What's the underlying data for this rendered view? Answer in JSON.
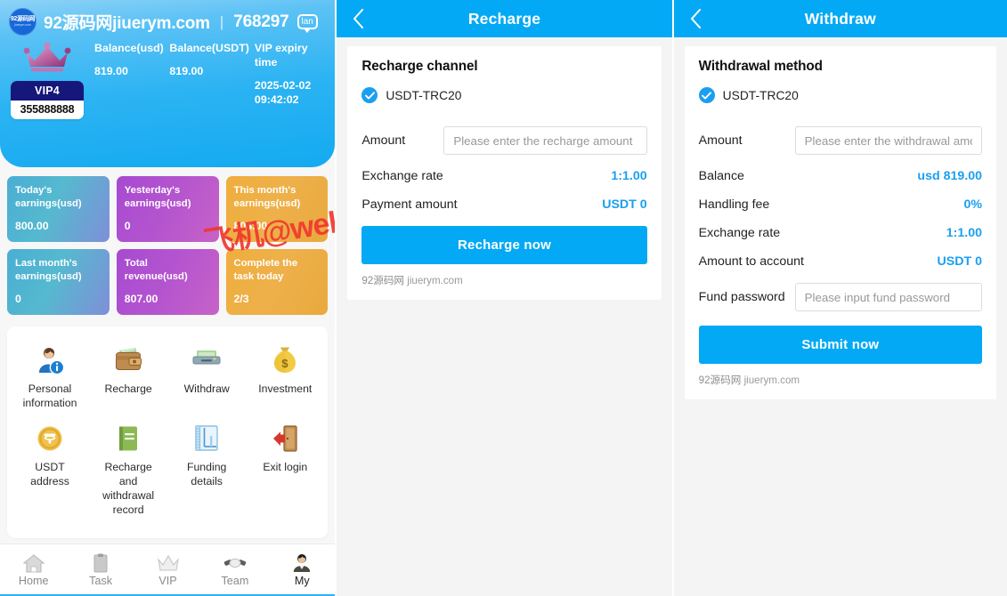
{
  "theme": {
    "accent": "#03a9f4",
    "hero_blue": "#2bb3f3",
    "card_teal": "#4aaed4",
    "card_purple": "#b455cf",
    "card_orange": "#eeb04a",
    "vip_navy": "#16177a",
    "value_blue": "#1a9ff0",
    "watermark_red": "#f0382f"
  },
  "watermark": {
    "text": "飞机@welunt"
  },
  "my_panel": {
    "header": {
      "logo_line1": "92源码网",
      "logo_line2": "jiuerym.com",
      "brand": "92源码网jiuerym.com",
      "divider": "|",
      "uid": "768297",
      "lang_badge": "lan",
      "message_badge": "•••"
    },
    "vip": {
      "level": "VIP4",
      "account": "355888888"
    },
    "balances": [
      {
        "label": "Balance(usd)",
        "value": "819.00"
      },
      {
        "label": "Balance(USDT)",
        "value": "819.00"
      },
      {
        "label": "VIP expiry time",
        "value": "2025-02-02 09:42:02"
      }
    ],
    "stat_cards": [
      {
        "label": "Today's earnings(usd)",
        "value": "800.00",
        "tone": "teal"
      },
      {
        "label": "Yesterday's earnings(usd)",
        "value": "0",
        "tone": "purple"
      },
      {
        "label": "This month's earnings(usd)",
        "value": "804.00",
        "tone": "orange"
      },
      {
        "label": "Last month's earnings(usd)",
        "value": "0",
        "tone": "teal"
      },
      {
        "label": "Total revenue(usd)",
        "value": "807.00",
        "tone": "purple"
      },
      {
        "label": "Complete the task today",
        "value": "2/3",
        "tone": "orange"
      }
    ],
    "menu": [
      {
        "label": "Personal information",
        "icon": "person-info-icon"
      },
      {
        "label": "Recharge",
        "icon": "wallet-icon"
      },
      {
        "label": "Withdraw",
        "icon": "atm-cash-icon"
      },
      {
        "label": "Investment",
        "icon": "money-bag-icon"
      },
      {
        "label": "USDT address",
        "icon": "usdt-coin-icon"
      },
      {
        "label": "Recharge and withdrawal record",
        "icon": "ledger-book-icon"
      },
      {
        "label": "Funding details",
        "icon": "notebook-chart-icon"
      },
      {
        "label": "Exit login",
        "icon": "exit-door-icon"
      }
    ],
    "tabbar": [
      {
        "label": "Home",
        "icon": "home-icon",
        "active": false
      },
      {
        "label": "Task",
        "icon": "clipboard-icon",
        "active": false
      },
      {
        "label": "VIP",
        "icon": "crown-icon",
        "active": false
      },
      {
        "label": "Team",
        "icon": "handshake-icon",
        "active": false
      },
      {
        "label": "My",
        "icon": "user-avatar-icon",
        "active": true
      }
    ]
  },
  "recharge_panel": {
    "navbar": {
      "title": "Recharge",
      "back_icon": "chevron-left-icon"
    },
    "section_title": "Recharge channel",
    "channel": {
      "name": "USDT-TRC20",
      "selected": true
    },
    "amount": {
      "label": "Amount",
      "value": "",
      "placeholder": "Please enter the recharge amount"
    },
    "rows": [
      {
        "label": "Exchange rate",
        "value": "1:1.00"
      },
      {
        "label": "Payment amount",
        "value": "USDT 0"
      }
    ],
    "cta": "Recharge now",
    "footer_zh": "92源码网",
    "footer_en": "jiuerym.com"
  },
  "withdraw_panel": {
    "navbar": {
      "title": "Withdraw",
      "back_icon": "chevron-left-icon"
    },
    "section_title": "Withdrawal method",
    "channel": {
      "name": "USDT-TRC20",
      "selected": true
    },
    "amount": {
      "label": "Amount",
      "value": "",
      "placeholder": "Please enter the withdrawal amount"
    },
    "rows": [
      {
        "label": "Balance",
        "value": "usd 819.00"
      },
      {
        "label": "Handling fee",
        "value": "0%"
      },
      {
        "label": "Exchange rate",
        "value": "1:1.00"
      },
      {
        "label": "Amount to account",
        "value": "USDT 0"
      }
    ],
    "fund_password": {
      "label": "Fund password",
      "value": "",
      "placeholder": "Please input fund password"
    },
    "cta": "Submit now",
    "footer_zh": "92源码网",
    "footer_en": "jiuerym.com"
  }
}
